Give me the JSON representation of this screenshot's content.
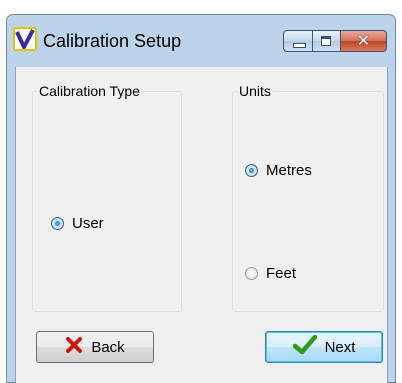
{
  "window": {
    "title": "Calibration Setup"
  },
  "calibration_type": {
    "legend": "Calibration Type",
    "options": [
      {
        "label": "User",
        "checked": true
      }
    ]
  },
  "units": {
    "legend": "Units",
    "options": [
      {
        "label": "Metres",
        "checked": true
      },
      {
        "label": "Feet",
        "checked": false
      }
    ]
  },
  "buttons": {
    "back": {
      "label": "Back",
      "icon": "red-x-icon"
    },
    "next": {
      "label": "Next",
      "icon": "green-check-icon"
    }
  },
  "colors": {
    "frame": "#bcd3ea",
    "close_button": "#c2451f",
    "check_green": "#2f9a1a",
    "x_red": "#c8170a"
  }
}
